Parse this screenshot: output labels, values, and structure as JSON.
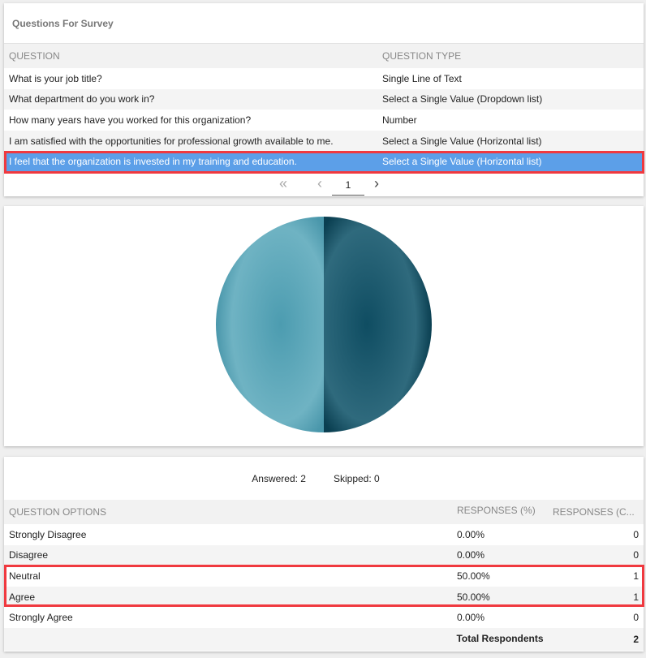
{
  "questions_panel": {
    "title": "Questions For Survey",
    "columns": [
      "QUESTION",
      "QUESTION TYPE"
    ],
    "rows": [
      {
        "question": "What is your job title?",
        "type": "Single Line of Text"
      },
      {
        "question": "What department do you work in?",
        "type": "Select a Single Value (Dropdown list)"
      },
      {
        "question": "How many years have you worked for this organization?",
        "type": "Number"
      },
      {
        "question": "I am satisfied with the opportunities for professional growth available to me.",
        "type": "Select a Single Value (Horizontal list)"
      },
      {
        "question": "I feel that the organization is invested in my training and education.",
        "type": "Select a Single Value (Horizontal list)",
        "selected": true
      }
    ],
    "pager": {
      "first_icon": "double-chevron-left-icon",
      "prev_icon": "chevron-left-icon",
      "page": "1",
      "next_icon": "chevron-right-icon"
    }
  },
  "chart_data": {
    "type": "pie",
    "categories": [
      "Neutral",
      "Agree"
    ],
    "values": [
      50,
      50
    ],
    "colors": [
      "#0f4d62",
      "#5aa5b8"
    ]
  },
  "results": {
    "answered": "Answered: 2",
    "skipped": "Skipped: 0",
    "columns": [
      "QUESTION OPTIONS",
      "RESPONSES (%)",
      "RESPONSES (C..."
    ],
    "rows": [
      {
        "option": "Strongly Disagree",
        "pct": "0.00%",
        "count": "0"
      },
      {
        "option": "Disagree",
        "pct": "0.00%",
        "count": "0"
      },
      {
        "option": "Neutral",
        "pct": "50.00%",
        "count": "1"
      },
      {
        "option": "Agree",
        "pct": "50.00%",
        "count": "1"
      },
      {
        "option": "Strongly Agree",
        "pct": "0.00%",
        "count": "0"
      }
    ],
    "total_label": "Total Respondents",
    "total": "2"
  },
  "highlight_color": "#f0393f",
  "selection_color": "#5c9fe8"
}
